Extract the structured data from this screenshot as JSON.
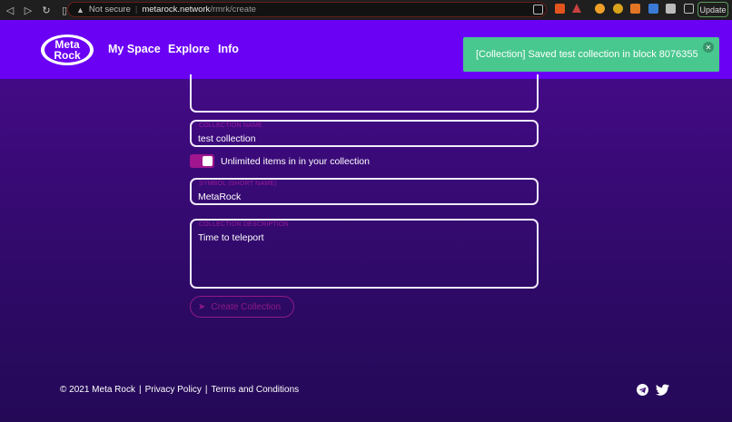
{
  "browser": {
    "security_label": "Not secure",
    "url_host": "metarock.network",
    "url_path": "/rmrk/create",
    "update_label": "Update"
  },
  "header": {
    "nav": [
      "My Space",
      "Explore",
      "Info"
    ]
  },
  "toast": {
    "message": "[Collection] Saved test collection in block 8076355"
  },
  "form": {
    "collection_name": {
      "label": "COLLECTION NAME",
      "value": "test collection"
    },
    "unlimited_label": "Unlimited items in in your collection",
    "symbol": {
      "label": "SYMBOL (SHORT NAME)",
      "value": "MetaRock"
    },
    "description": {
      "label": "COLLECTION DESCRIPTION",
      "value": "Time to teleport"
    },
    "create_label": "Create Collection"
  },
  "footer": {
    "copyright": "© 2021 Meta Rock",
    "sep1": "|",
    "privacy": "Privacy Policy",
    "sep2": "|",
    "terms": "Terms and Conditions"
  },
  "icons": {
    "social": [
      "telegram-icon",
      "twitter-icon"
    ]
  },
  "colors": {
    "header": "#6a00f4",
    "toast": "#48c78e",
    "accent": "#9c1a9c"
  }
}
